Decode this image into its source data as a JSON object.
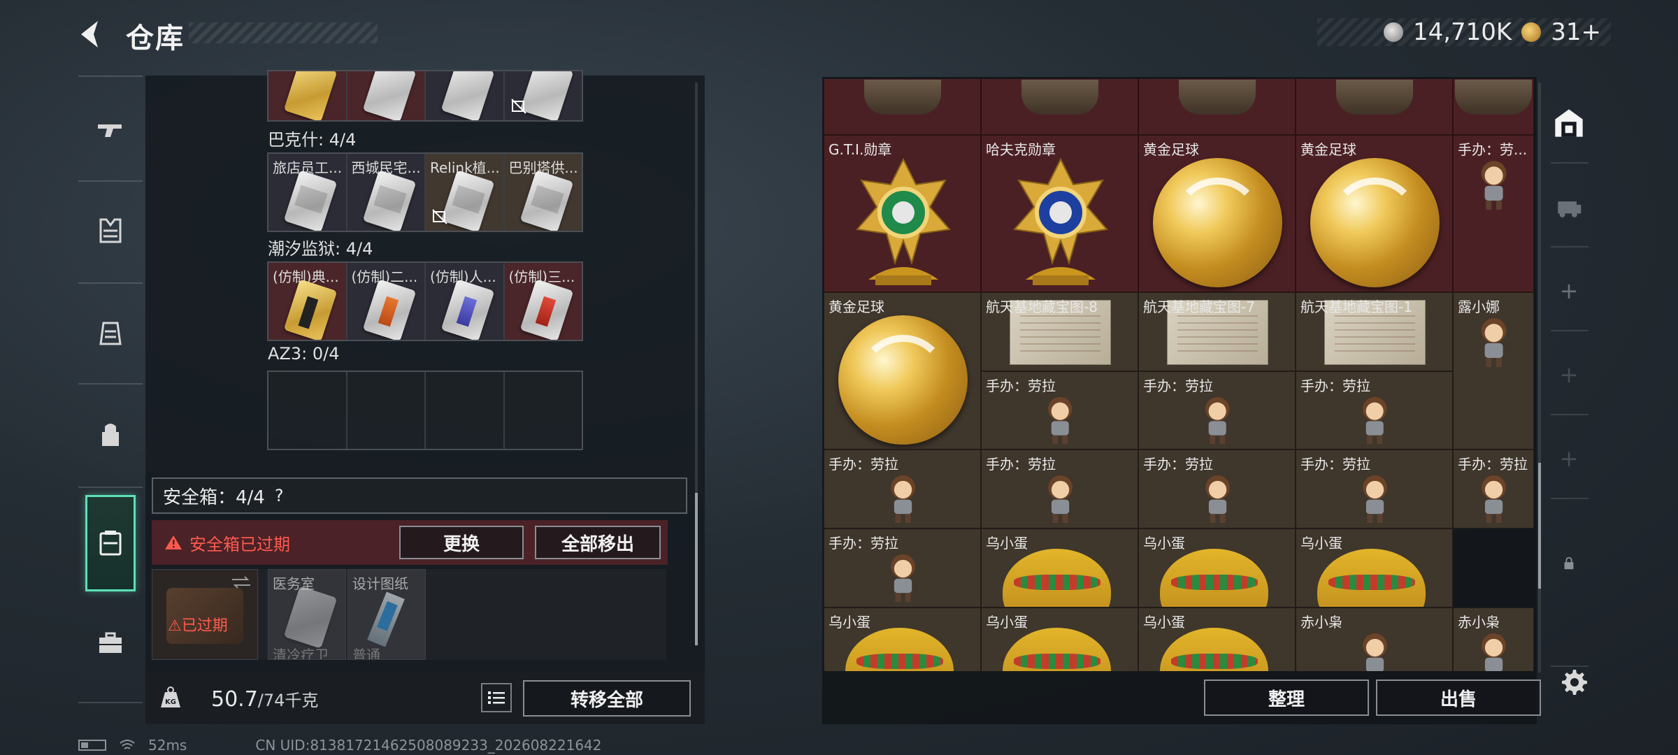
{
  "header": {
    "title": "仓库",
    "currency": [
      {
        "icon": "silver-coin-icon",
        "value": "14,710K"
      },
      {
        "icon": "gold-coin-icon",
        "value": "31+"
      }
    ]
  },
  "side_nav": {
    "items": [
      "gun-icon",
      "vest-icon",
      "backpack-rig-icon",
      "backpack-icon",
      "safe-box-icon",
      "toolbox-icon"
    ],
    "active": "safe-box-icon"
  },
  "left_panel": {
    "groups": [
      {
        "label": "巴克什: 4/4",
        "slots": [
          "旅店员工...",
          "西城民宅...",
          "Relink植...",
          "巴别塔供..."
        ]
      },
      {
        "label": "潮汐监狱: 4/4",
        "slots": [
          "(仿制)典...",
          "(仿制)二...",
          "(仿制)人...",
          "(仿制)三..."
        ]
      },
      {
        "label": "AZ3: 0/4",
        "slots": [
          "",
          "",
          "",
          ""
        ]
      }
    ],
    "safe_box": {
      "label": "安全箱：4/4",
      "help": "?",
      "expired_text": "安全箱已过期",
      "replace_label": "更换",
      "remove_all_label": "全部移出",
      "expired_badge": "已过期",
      "slots": [
        {
          "label": "医务室",
          "sub": "清冷疗卫"
        },
        {
          "label": "设计图纸",
          "sub": "普通"
        }
      ]
    },
    "weight": {
      "current": "50.7",
      "max": "/74千克"
    },
    "transfer_all_label": "转移全部"
  },
  "grid": {
    "rows": [
      [
        {
          "label": "",
          "bg": "maroon"
        },
        {
          "label": "",
          "bg": "maroon"
        },
        {
          "label": "",
          "bg": "maroon"
        },
        {
          "label": "",
          "bg": "maroon"
        },
        {
          "label": "",
          "bg": "maroon"
        }
      ],
      [
        {
          "label": "G.T.I.勋章",
          "bg": "maroon",
          "art": "gti-medal"
        },
        {
          "label": "哈夫克勋章",
          "bg": "maroon",
          "art": "haavk-medal"
        },
        {
          "label": "黄金足球",
          "bg": "maroon",
          "art": "ball"
        },
        {
          "label": "黄金足球",
          "bg": "maroon",
          "art": "ball"
        },
        {
          "label": "手办：劳...",
          "bg": "maroon",
          "art": "figure"
        }
      ],
      [
        {
          "label": "黄金足球",
          "bg": "brownc",
          "art": "ball"
        },
        {
          "label": "航天基地藏宝图-8",
          "bg": "brownc",
          "art": "map"
        },
        {
          "label": "航天基地藏宝图-7",
          "bg": "brownc",
          "art": "map"
        },
        {
          "label": "航天基地藏宝图-1",
          "bg": "brownc",
          "art": "map"
        },
        {
          "label": "露小娜",
          "bg": "brownc",
          "art": "figure"
        }
      ],
      [
        {
          "label": "手办：劳拉",
          "bg": "brownc",
          "art": "figure"
        },
        {
          "label": "手办：劳拉",
          "bg": "brownc",
          "art": "figure"
        },
        {
          "label": "手办：劳拉",
          "bg": "brownc",
          "art": "figure"
        },
        {
          "label": "手办：劳拉",
          "bg": "brownc",
          "art": "figure"
        },
        {
          "label": "手办：劳拉",
          "bg": "brownc",
          "art": "figure"
        }
      ],
      [
        {
          "label": "手办：劳拉",
          "bg": "brownc",
          "art": "figure"
        },
        {
          "label": "乌小蛋",
          "bg": "brownc",
          "art": "egg"
        },
        {
          "label": "乌小蛋",
          "bg": "brownc",
          "art": "egg"
        },
        {
          "label": "乌小蛋",
          "bg": "brownc",
          "art": "egg"
        }
      ],
      [
        {
          "label": "乌小蛋",
          "bg": "brownc",
          "art": "egg"
        },
        {
          "label": "乌小蛋",
          "bg": "brownc",
          "art": "egg"
        },
        {
          "label": "乌小蛋",
          "bg": "brownc",
          "art": "egg"
        },
        {
          "label": "赤小枭",
          "bg": "brownc",
          "art": "figure"
        },
        {
          "label": "赤小枭",
          "bg": "brownc",
          "art": "figure"
        }
      ]
    ],
    "lara_under_maps": [
      "手办：劳拉",
      "手办：劳拉",
      "手办：劳拉"
    ]
  },
  "right_actions": {
    "tidy_label": "整理",
    "sell_label": "出售"
  },
  "status": {
    "ping": "52ms",
    "uid": "CN UID:8138172146250808923​3_202608221642"
  }
}
